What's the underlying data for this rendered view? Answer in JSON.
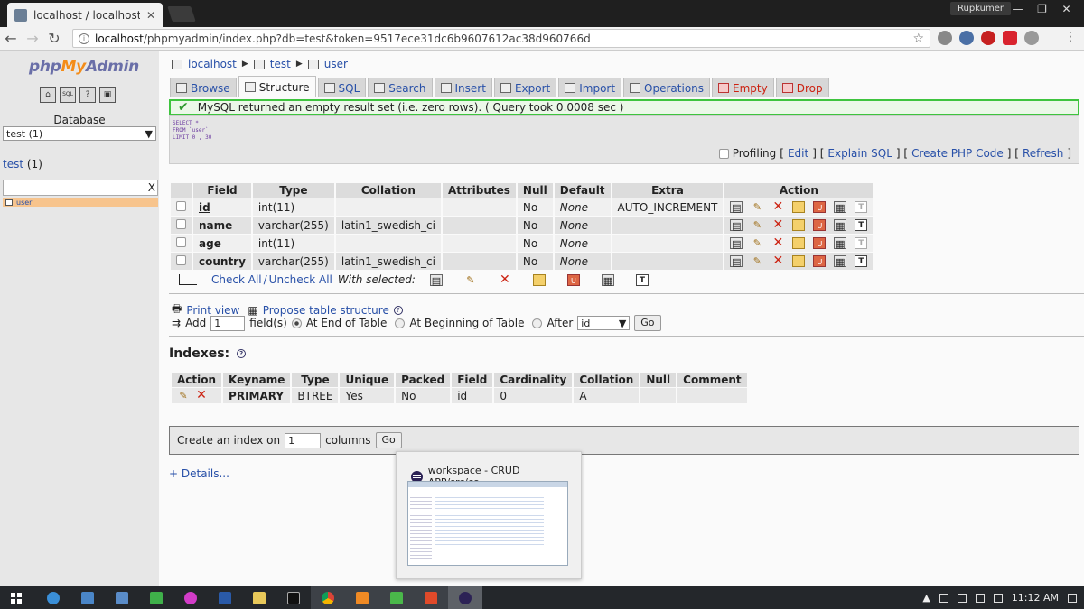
{
  "browser": {
    "tab_title": "localhost / localhost / te",
    "tab_close": "✕",
    "user_name": "Rupkumer",
    "url_host": "localhost",
    "url_rest": "/phpmyadmin/index.php?db=test&token=9517ece31dc6b9607612ac38d960766d"
  },
  "sidebar": {
    "logo_php": "php",
    "logo_my": "My",
    "logo_admin": "Admin",
    "home_icons": [
      "⌂",
      "SQL",
      "?",
      "▣"
    ],
    "database_label": "Database",
    "database_select": "test (1)",
    "db_link": "test",
    "db_count": "(1)",
    "filter_clear": "X",
    "tables": [
      "user"
    ]
  },
  "breadcrumb": {
    "server": "localhost",
    "database": "test",
    "table": "user"
  },
  "tabs": [
    {
      "label": "Browse",
      "active": false
    },
    {
      "label": "Structure",
      "active": true
    },
    {
      "label": "SQL",
      "active": false
    },
    {
      "label": "Search",
      "active": false
    },
    {
      "label": "Insert",
      "active": false
    },
    {
      "label": "Export",
      "active": false
    },
    {
      "label": "Import",
      "active": false
    },
    {
      "label": "Operations",
      "active": false
    },
    {
      "label": "Empty",
      "active": false
    },
    {
      "label": "Drop",
      "active": false
    }
  ],
  "message": {
    "text": "MySQL returned an empty result set (i.e. zero rows). ( Query took 0.0008 sec )"
  },
  "sql": {
    "query": "SELECT *\nFROM `user`\nLIMIT 0 , 30",
    "profiling": "Profiling",
    "edit": "Edit",
    "explain": "Explain SQL",
    "create_php": "Create PHP Code",
    "refresh": "Refresh"
  },
  "structure": {
    "headers": [
      "Field",
      "Type",
      "Collation",
      "Attributes",
      "Null",
      "Default",
      "Extra",
      "Action"
    ],
    "rows": [
      {
        "field": "id",
        "type": "int(11)",
        "collation": "",
        "attributes": "",
        "null": "No",
        "default": "None",
        "extra": "AUTO_INCREMENT"
      },
      {
        "field": "name",
        "type": "varchar(255)",
        "collation": "latin1_swedish_ci",
        "attributes": "",
        "null": "No",
        "default": "None",
        "extra": ""
      },
      {
        "field": "age",
        "type": "int(11)",
        "collation": "",
        "attributes": "",
        "null": "No",
        "default": "None",
        "extra": ""
      },
      {
        "field": "country",
        "type": "varchar(255)",
        "collation": "latin1_swedish_ci",
        "attributes": "",
        "null": "No",
        "default": "None",
        "extra": ""
      }
    ],
    "check_all": "Check All",
    "uncheck_all": "Uncheck All",
    "separator": " / ",
    "with_selected": "With selected:"
  },
  "table_ops": {
    "print_view": "Print view",
    "propose": "Propose table structure",
    "add": "Add",
    "add_value": "1",
    "fields": "field(s)",
    "at_end": "At End of Table",
    "at_beginning": "At Beginning of Table",
    "after": "After",
    "after_value": "id",
    "go": "Go"
  },
  "indexes": {
    "title": "Indexes:",
    "headers": [
      "Action",
      "Keyname",
      "Type",
      "Unique",
      "Packed",
      "Field",
      "Cardinality",
      "Collation",
      "Null",
      "Comment"
    ],
    "rows": [
      {
        "keyname": "PRIMARY",
        "type": "BTREE",
        "unique": "Yes",
        "packed": "No",
        "field": "id",
        "cardinality": "0",
        "collation": "A",
        "null": "",
        "comment": ""
      }
    ],
    "create_label": "Create an index on",
    "create_value": "1",
    "columns": "columns",
    "go": "Go",
    "details": "+ Details..."
  },
  "preview": {
    "title": "workspace - CRUD APP/src/co..."
  },
  "taskbar": {
    "time": "11:12 AM"
  },
  "colors": {
    "link": "#2850a8",
    "success_border": "#3ec43e",
    "logo_orange": "#f48c18",
    "logo_purple": "#6a6fa8"
  }
}
